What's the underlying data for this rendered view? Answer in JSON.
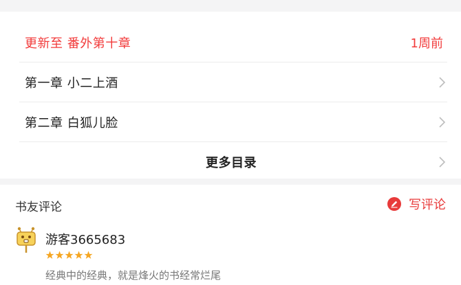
{
  "chapters": {
    "latest": {
      "label": "更新至 番外第十章",
      "time": "1周前"
    },
    "items": [
      {
        "label": "第一章 小二上酒"
      },
      {
        "label": "第二章 白狐儿脸"
      }
    ],
    "more_label": "更多目录"
  },
  "comments": {
    "title": "书友评论",
    "write_label": "写评论",
    "list": [
      {
        "user": "游客3665683",
        "rating": 5,
        "text": "经典中的经典，就是烽火的书经常烂尾"
      }
    ]
  },
  "colors": {
    "accent": "#f23b3b",
    "star": "#f5a623",
    "background_gap": "#f4f4f5"
  },
  "icons": {
    "chevron": "chevron-right-icon",
    "write": "edit-pencil-icon",
    "avatar": "guest-avatar-icon",
    "star": "star-icon"
  }
}
